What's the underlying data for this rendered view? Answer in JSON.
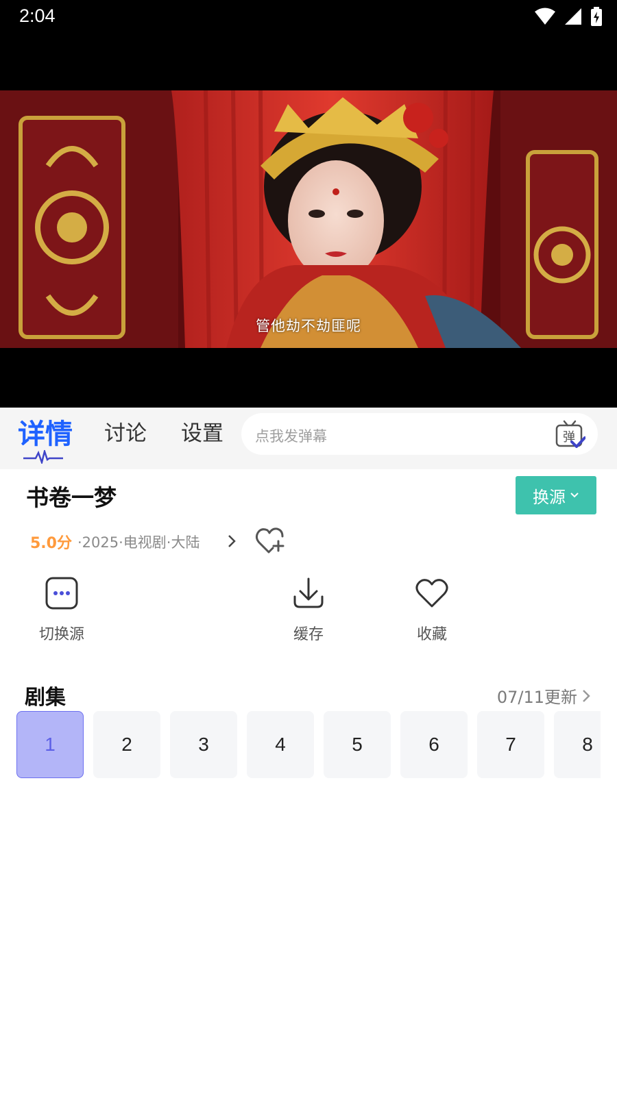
{
  "status": {
    "time": "2:04"
  },
  "player": {
    "subtitle": "管他劫不劫匪呢"
  },
  "tabs": [
    {
      "label": "详情",
      "active": true
    },
    {
      "label": "讨论",
      "active": false
    },
    {
      "label": "设置",
      "active": false
    }
  ],
  "danmaku": {
    "placeholder": "点我发弹幕",
    "icon_char": "弹"
  },
  "show": {
    "title": "书卷一梦",
    "source_button": "换源",
    "score": "5.0分",
    "meta": "·2025·电视剧·大陆"
  },
  "actions": [
    {
      "label": "切换源",
      "icon": "more-icon"
    },
    {
      "label": "缓存",
      "icon": "download-icon"
    },
    {
      "label": "收藏",
      "icon": "heart-icon"
    }
  ],
  "episodes": {
    "title": "剧集",
    "update": "07/11更新",
    "items": [
      "1",
      "2",
      "3",
      "4",
      "5",
      "6",
      "7",
      "8"
    ],
    "selected": "1"
  },
  "colors": {
    "accent_blue": "#1f62ff",
    "source_button": "#3ec2ad",
    "score": "#ff9a3c",
    "episode_selected": "#b3b5f8"
  }
}
